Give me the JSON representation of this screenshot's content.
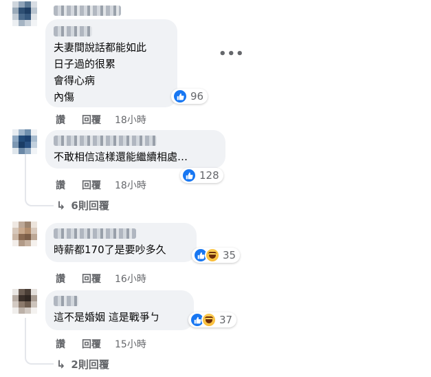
{
  "comments": [
    {
      "text": "夫妻間說話都能如此\n日子過的很累\n會得心病\n內傷",
      "reaction_count": "96",
      "like_label": "讚",
      "reply_label": "回覆",
      "time": "18小時"
    },
    {
      "text": "不敢相信這樣還能繼續相處…",
      "reaction_count": "128",
      "like_label": "讚",
      "reply_label": "回覆",
      "time": "18小時",
      "replies_label": "6則回覆"
    },
    {
      "text": "時薪都170了是要吵多久",
      "reaction_count": "35",
      "like_label": "讚",
      "reply_label": "回覆",
      "time": "16小時"
    },
    {
      "text": "這不是婚姻 這是戰爭ㄅ",
      "reaction_count": "37",
      "like_label": "讚",
      "reply_label": "回覆",
      "time": "15小時",
      "replies_label": "2則回覆"
    }
  ],
  "icons": {
    "like": "thumbs-up-icon",
    "haha": "haha-emoji-icon",
    "more": "more-options-icon",
    "reply_arrow": "reply-arrow-icon"
  },
  "colors": {
    "bubble": "#f0f2f5",
    "like_blue": "#1877f2",
    "meta_gray": "#65676b"
  }
}
